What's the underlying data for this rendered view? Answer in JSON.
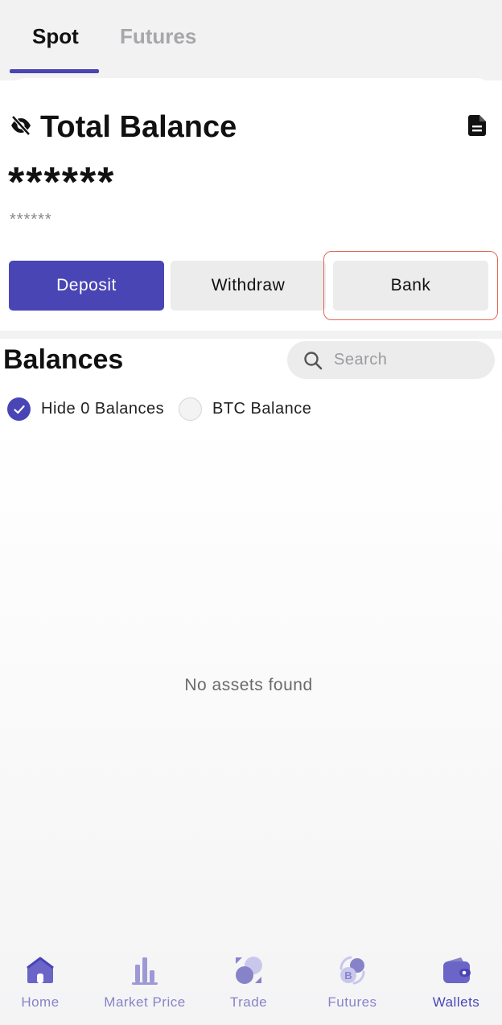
{
  "tabs": {
    "spot": "Spot",
    "futures": "Futures"
  },
  "card": {
    "title": "Total Balance",
    "masked_total": "******",
    "masked_sub": "******",
    "buttons": {
      "deposit": "Deposit",
      "withdraw": "Withdraw",
      "bank": "Bank"
    }
  },
  "balances": {
    "title": "Balances",
    "search_placeholder": "Search",
    "filters": {
      "hide_zero": "Hide 0 Balances",
      "btc": "BTC Balance"
    },
    "empty_text": "No assets found"
  },
  "nav": {
    "home": "Home",
    "market": "Market Price",
    "trade": "Trade",
    "futures": "Futures",
    "wallets": "Wallets"
  },
  "colors": {
    "accent": "#4a45b5",
    "nav_inactive": "#8783c9",
    "highlight": "#e06a55"
  }
}
